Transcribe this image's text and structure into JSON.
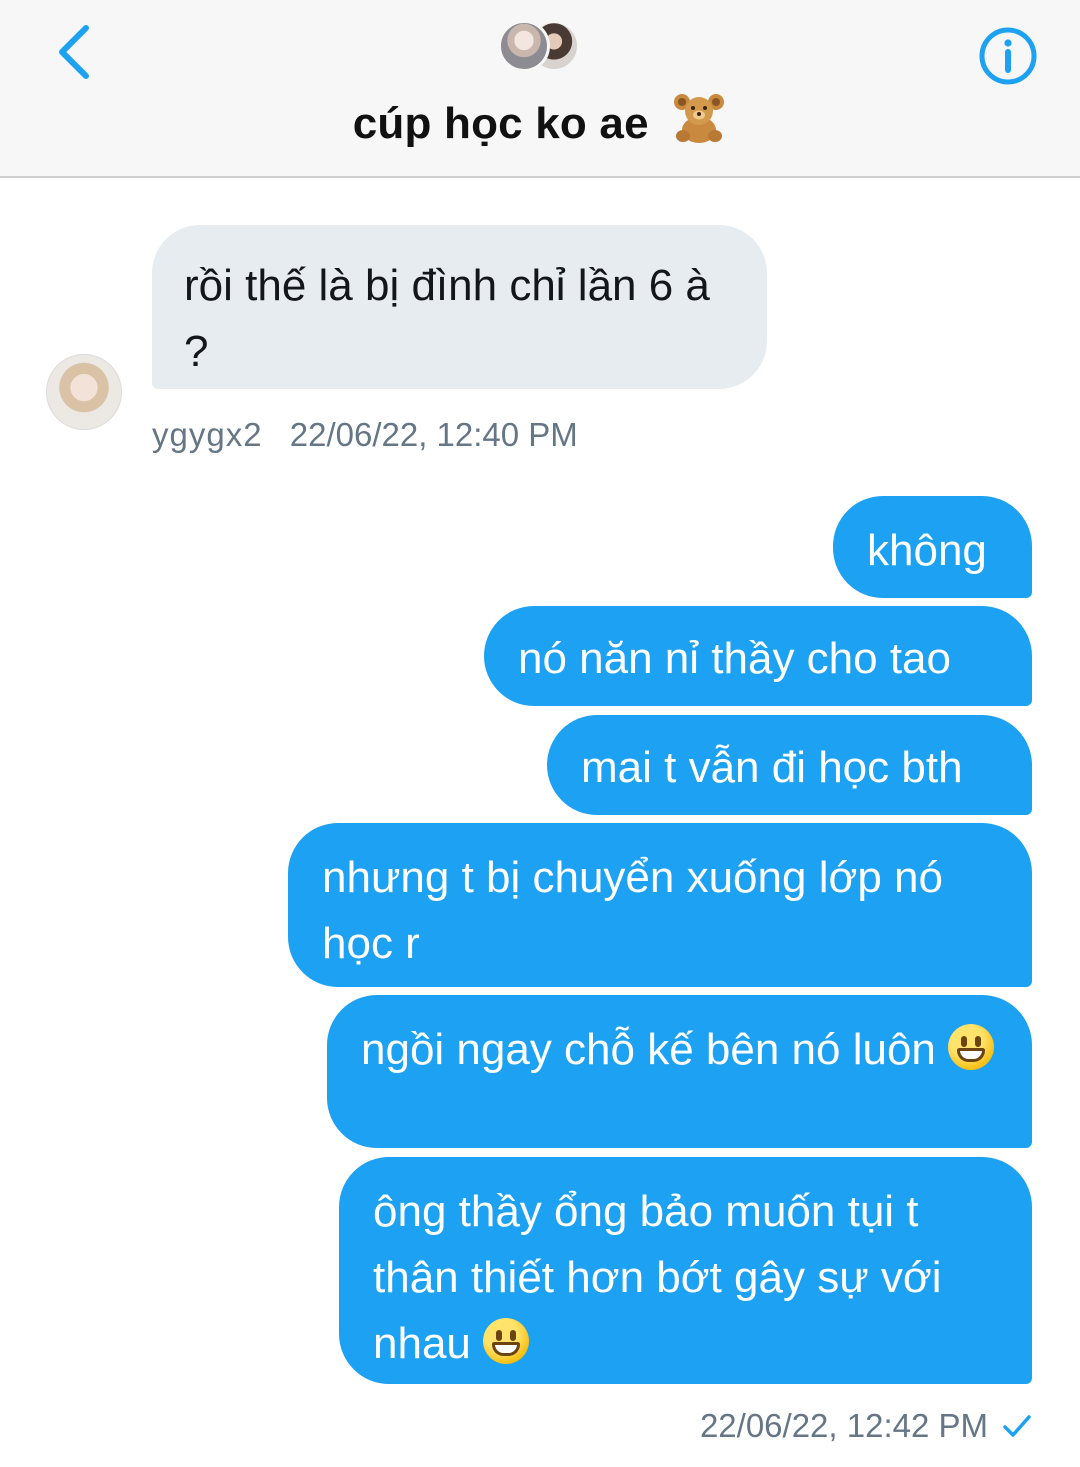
{
  "header": {
    "title": "cúp học ko ae",
    "title_emoji": "teddy-bear-icon",
    "back_icon": "chevron-left-icon",
    "info_icon": "info-icon",
    "accent_color": "#1da1f2"
  },
  "messages": {
    "incoming": {
      "text": "rồi thế là bị đình chỉ lần 6 à ?",
      "sender": "ygygx2",
      "timestamp": "22/06/22, 12:40 PM"
    },
    "outgoing": [
      {
        "text": "không"
      },
      {
        "text": "nó năn nỉ thầy cho tao"
      },
      {
        "text": "mai t vẫn đi học bth"
      },
      {
        "text": "nhưng t bị chuyển xuống lớp nó học r"
      },
      {
        "text": "ngồi ngay chỗ kế bên nó luôn",
        "emoji": "grinning-face-icon"
      },
      {
        "text": "ông thầy ổng bảo muốn tụi t thân thiết hơn bớt gây sự với nhau",
        "emoji": "grinning-face-icon"
      }
    ],
    "outgoing_timestamp": "22/06/22, 12:42 PM",
    "outgoing_status_icon": "checkmark-icon"
  },
  "colors": {
    "outgoing_bubble": "#1da1f2",
    "incoming_bubble": "#e6ecf0",
    "meta_text": "#657786"
  }
}
